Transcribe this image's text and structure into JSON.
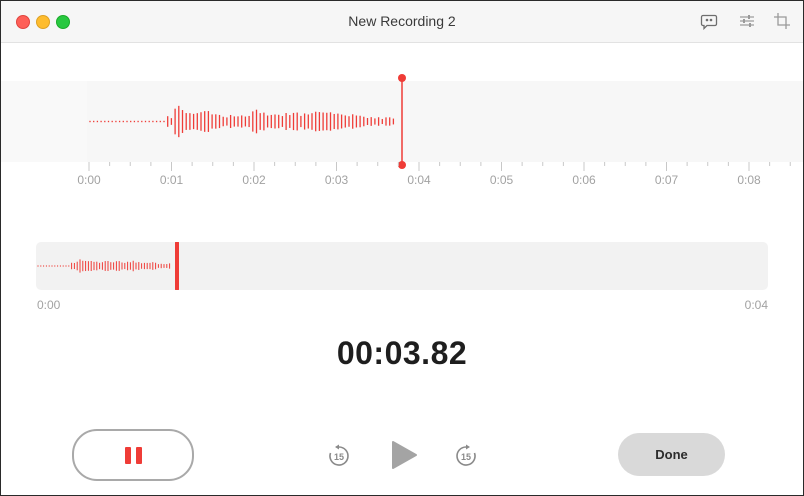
{
  "window": {
    "title": "New Recording 2",
    "toolbar": {
      "transcript_icon": "transcript-bubble-icon",
      "settings_icon": "sliders-icon",
      "trim_icon": "crop-trim-icon"
    }
  },
  "main_waveform": {
    "time_labels": [
      "0:00",
      "0:01",
      "0:02",
      "0:03",
      "0:04",
      "0:05",
      "0:06",
      "0:07",
      "0:08"
    ],
    "playhead_time_sec": 3.7
  },
  "overview": {
    "start_label": "0:00",
    "end_label": "0:04"
  },
  "timer": "00:03.82",
  "controls": {
    "pause_icon": "pause-icon",
    "skip_back_label": "15",
    "play_icon": "play-icon",
    "skip_forward_label": "15",
    "done_label": "Done"
  },
  "colors": {
    "accent": "#ef3c37",
    "waveform": "#ef3c37",
    "button_gray": "#d9d9d9"
  }
}
